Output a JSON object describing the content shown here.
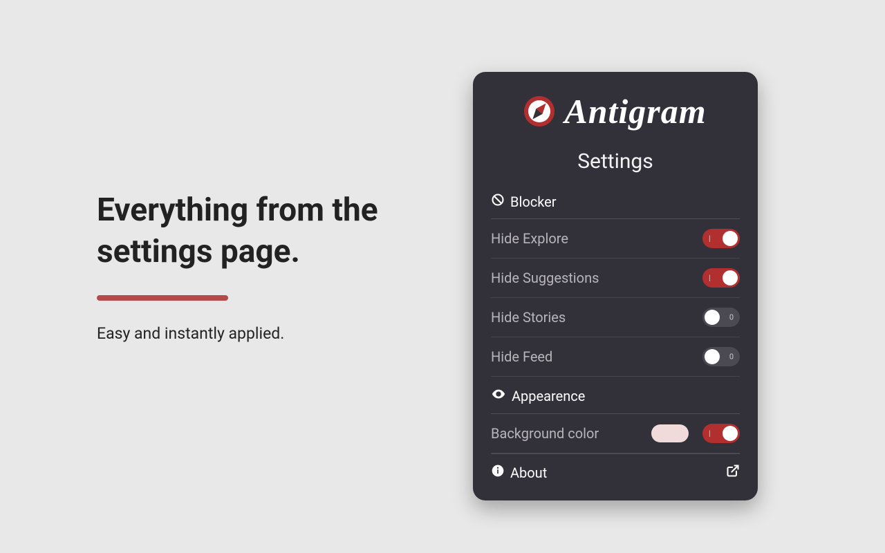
{
  "colors": {
    "accent": "#b22f2f",
    "panel_bg": "#32313a",
    "page_bg": "#e8e8e8",
    "swatch": "#f0dada"
  },
  "promo": {
    "headline": "Everything from the settings page.",
    "subline": "Easy and instantly applied."
  },
  "app": {
    "name": "Antigram",
    "settings_title": "Settings",
    "sections": {
      "blocker": {
        "title": "Blocker",
        "items": [
          {
            "label": "Hide Explore",
            "on": true
          },
          {
            "label": "Hide Suggestions",
            "on": true
          },
          {
            "label": "Hide Stories",
            "on": false
          },
          {
            "label": "Hide Feed",
            "on": false
          }
        ]
      },
      "appearance": {
        "title": "Appearence",
        "items": [
          {
            "label": "Background color",
            "swatch": "#f0dada",
            "on": true
          }
        ]
      },
      "about": {
        "title": "About"
      }
    }
  }
}
